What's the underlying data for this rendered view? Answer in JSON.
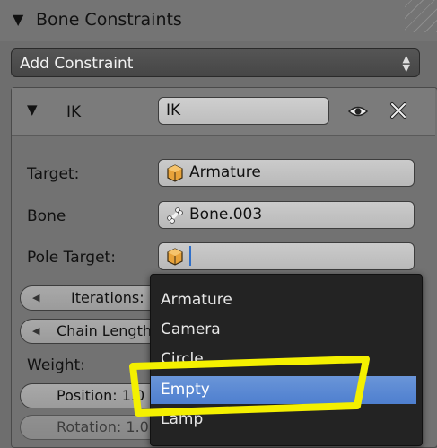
{
  "panel": {
    "title": "Bone Constraints"
  },
  "add_constraint": {
    "label": "Add Constraint"
  },
  "constraint": {
    "type_label": "IK",
    "name_value": "IK"
  },
  "fields": {
    "target": {
      "label": "Target:",
      "value": "Armature",
      "icon": "armature-cube-icon"
    },
    "bone": {
      "label": "Bone",
      "value": "Bone.003",
      "icon": "bone-icon"
    },
    "pole_target": {
      "label": "Pole Target:",
      "value": "",
      "icon": "armature-cube-icon"
    }
  },
  "sliders": {
    "iterations": "Iterations:",
    "chain_length": "Chain Length",
    "weight_label": "Weight:",
    "position": "Position: 1.0",
    "rotation": "Rotation: 1.0"
  },
  "dropdown": {
    "items": [
      "Armature",
      "Camera",
      "Circle",
      "Empty",
      "Lamp"
    ],
    "highlighted": "Empty"
  },
  "colors": {
    "highlight": "#5b8ad6",
    "annotation": "#f4f000",
    "dropdown_bg": "#232323"
  }
}
